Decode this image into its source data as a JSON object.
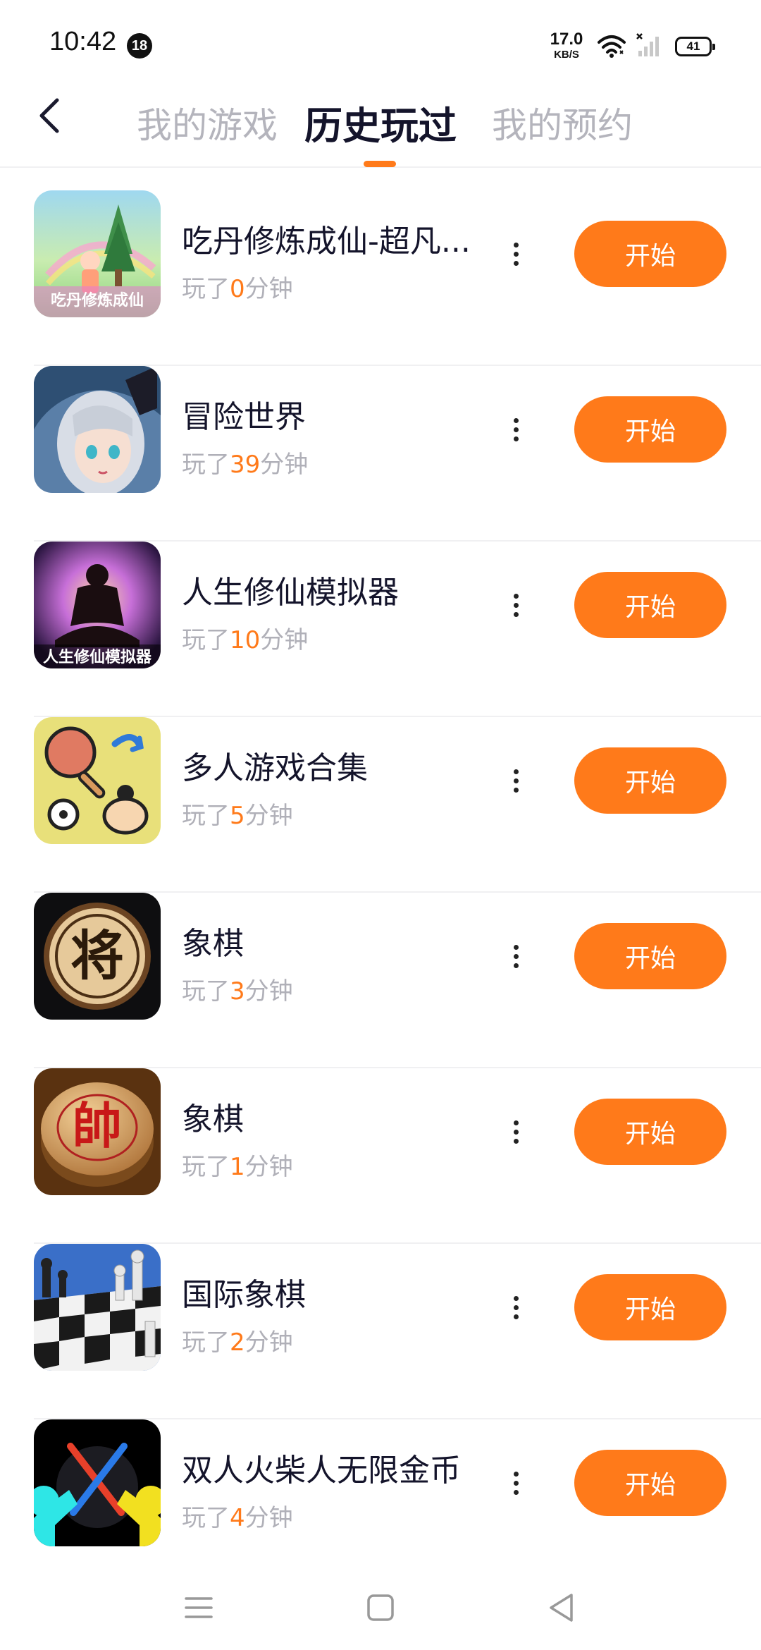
{
  "status_bar": {
    "time": "10:42",
    "badge": "18",
    "speed_value": "17.0",
    "speed_unit": "KB/S",
    "battery": "41",
    "icons": [
      "wifi-icon",
      "signal-icon",
      "battery-icon"
    ]
  },
  "header": {
    "back_icon": "back-arrow-icon",
    "tabs": [
      {
        "label": "我的游戏",
        "active": false
      },
      {
        "label": "历史玩过",
        "active": true
      },
      {
        "label": "我的预约",
        "active": false
      }
    ]
  },
  "played_prefix": "玩了",
  "played_suffix": "分钟",
  "games": [
    {
      "title": "吃丹修炼成仙-超凡...",
      "minutes": "0",
      "action": "开始",
      "icon": "alchemy-game-icon",
      "icon_caption": "吃丹修炼成仙"
    },
    {
      "title": "冒险世界",
      "minutes": "39",
      "action": "开始",
      "icon": "anime-girl-game-icon"
    },
    {
      "title": "人生修仙模拟器",
      "minutes": "10",
      "action": "开始",
      "icon": "meditation-game-icon",
      "icon_caption": "人生修仙模拟器"
    },
    {
      "title": "多人游戏合集",
      "minutes": "5",
      "action": "开始",
      "icon": "multiplayer-game-icon"
    },
    {
      "title": "象棋",
      "minutes": "3",
      "action": "开始",
      "icon": "xiangqi-jiang-icon",
      "icon_caption": "将"
    },
    {
      "title": "象棋",
      "minutes": "1",
      "action": "开始",
      "icon": "xiangqi-shuai-icon",
      "icon_caption": "帥"
    },
    {
      "title": "国际象棋",
      "minutes": "2",
      "action": "开始",
      "icon": "chess-board-icon"
    },
    {
      "title": "双人火柴人无限金币",
      "minutes": "4",
      "action": "开始",
      "icon": "stickman-game-icon"
    }
  ],
  "nav_bar": {
    "icons": [
      "menu-nav-icon",
      "home-nav-icon",
      "back-nav-icon"
    ]
  },
  "colors": {
    "accent": "#ff7a1a",
    "title_text": "#14142b",
    "muted_text": "#b0b0b8",
    "divider": "#f0f0f2"
  }
}
